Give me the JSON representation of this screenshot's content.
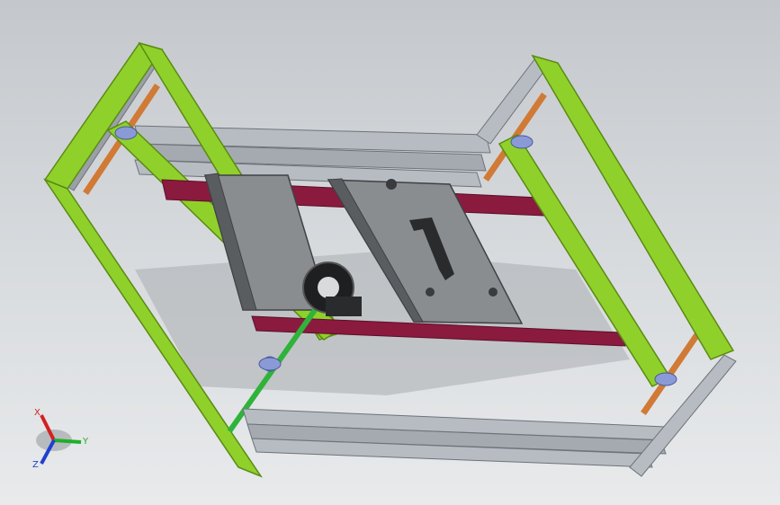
{
  "view": {
    "background_top": "#c4c8cc",
    "background_bottom": "#e8eaec"
  },
  "colors": {
    "frame_green": "#8fd12a",
    "frame_green_dark": "#5b8a14",
    "rail_silver": "#b7bcc2",
    "rail_dark": "#6e737a",
    "crossbar_maroon": "#8b1a3f",
    "rod_copper": "#d07a35",
    "mold_gray": "#8a8d90",
    "mold_dark": "#5a5d60",
    "shaft_green": "#2fb33a",
    "flange_blue": "#8a9ad6"
  },
  "triad": {
    "x_label": "X",
    "y_label": "Y",
    "z_label": "Z",
    "x_color": "#d42020",
    "y_color": "#1fae2a",
    "z_color": "#2040d0"
  }
}
